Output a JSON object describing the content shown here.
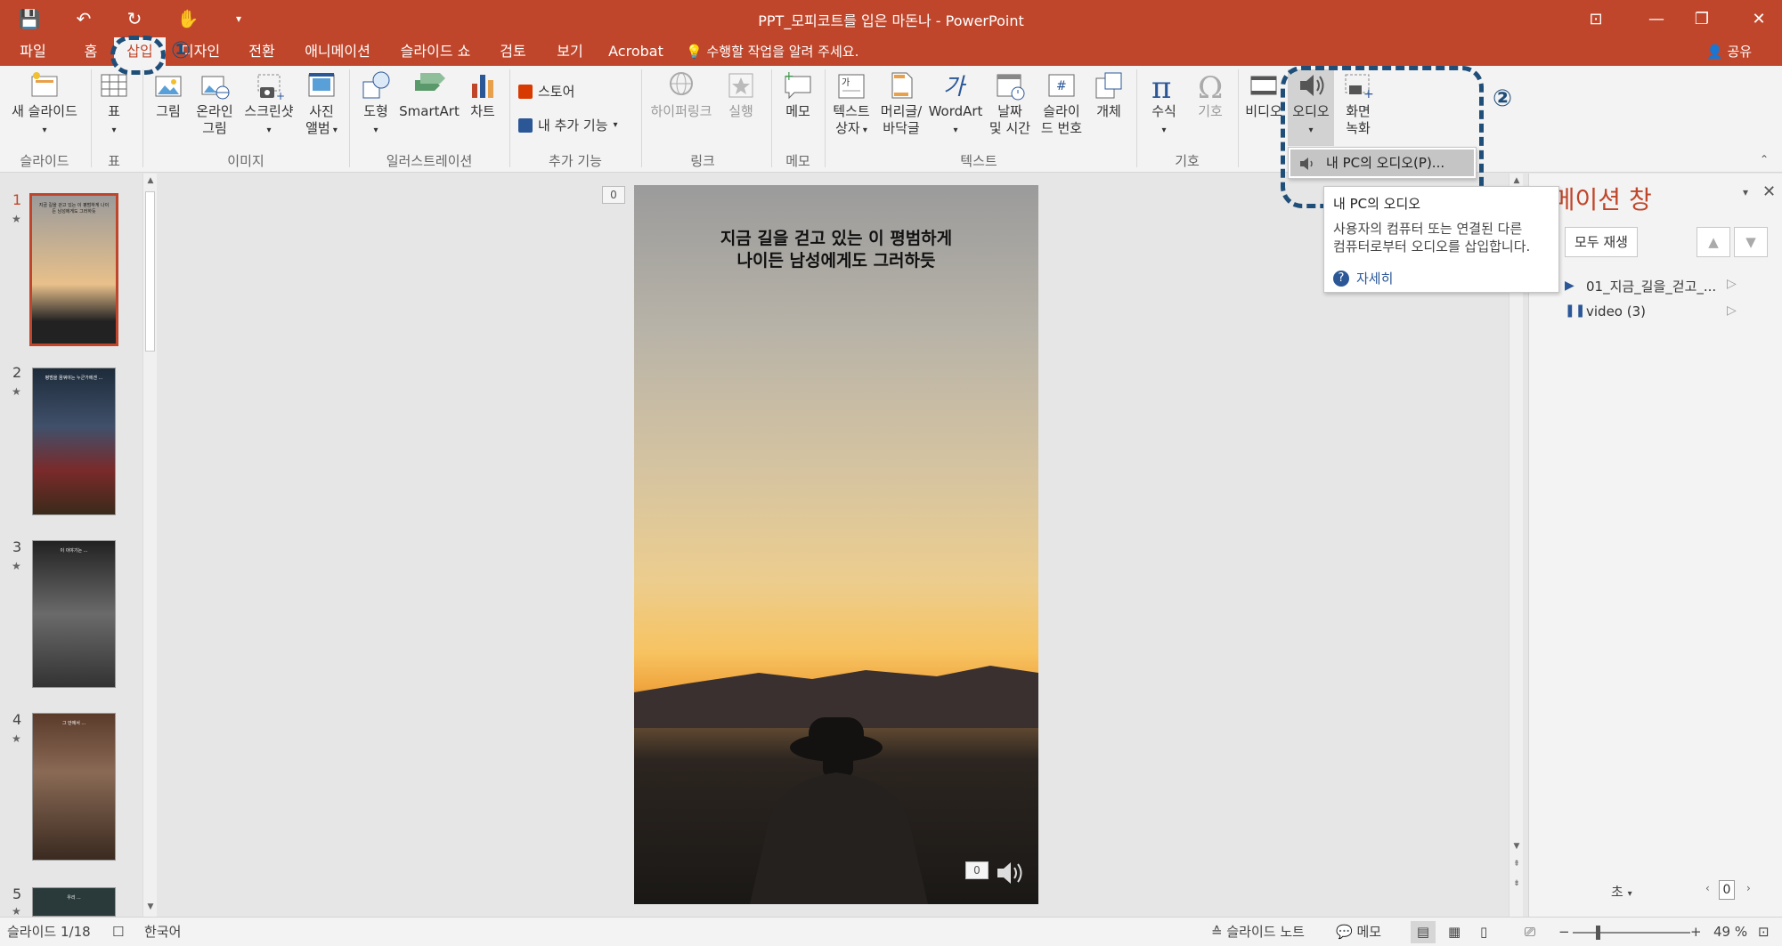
{
  "window": {
    "title": "PPT_모피코트를 입은 마돈나 - PowerPoint",
    "controls": {
      "ribbon_display": "⊡",
      "minimize": "—",
      "restore": "❐",
      "close": "✕"
    },
    "quick_access": {
      "save": "💾",
      "undo": "↶",
      "redo": "↻",
      "touch": "✋",
      "customize": "▾"
    }
  },
  "tabs": [
    {
      "label": "파일"
    },
    {
      "label": "홈"
    },
    {
      "label": "삽입"
    },
    {
      "label": "디자인"
    },
    {
      "label": "전환"
    },
    {
      "label": "애니메이션"
    },
    {
      "label": "슬라이드 쇼"
    },
    {
      "label": "검토"
    },
    {
      "label": "보기"
    },
    {
      "label": "Acrobat"
    }
  ],
  "tell_me": "수행할 작업을 알려 주세요.",
  "share": "공유",
  "ribbon": {
    "new_slide": "새 슬라이드",
    "table": "표",
    "picture": "그림",
    "online_picture_l1": "온라인",
    "online_picture_l2": "그림",
    "screenshot": "스크린샷",
    "photo_album_l1": "사진",
    "photo_album_l2": "앨범",
    "shapes": "도형",
    "smartart": "SmartArt",
    "chart": "차트",
    "store": "스토어",
    "my_addins": "내 추가 기능",
    "hyperlink": "하이퍼링크",
    "action": "실행",
    "comment": "메모",
    "textbox_l1": "텍스트",
    "textbox_l2": "상자",
    "header_footer_l1": "머리글/",
    "header_footer_l2": "바닥글",
    "wordart": "WordArt",
    "datetime_l1": "날짜",
    "datetime_l2": "및 시간",
    "slide_number_l1": "슬라이",
    "slide_number_l2": "드 번호",
    "object": "개체",
    "equation": "수식",
    "symbol": "기호",
    "video": "비디오",
    "audio": "오디오",
    "screen_rec_l1": "화면",
    "screen_rec_l2": "녹화",
    "groups": {
      "slides": "슬라이드",
      "tables": "표",
      "images": "이미지",
      "illustrations": "일러스트레이션",
      "addins": "추가 기능",
      "links": "링크",
      "comments": "메모",
      "text": "텍스트",
      "symbols": "기호"
    }
  },
  "dropdown": {
    "item": "내 PC의 오디오(P)..."
  },
  "tooltip": {
    "title": "내 PC의 오디오",
    "desc_l1": "사용자의 컴퓨터 또는 연결된 다른",
    "desc_l2": "컴퓨터로부터 오디오를 삽입합니다.",
    "more": "자세히"
  },
  "annotations": {
    "one": "①",
    "two": "②"
  },
  "slide": {
    "caption_l1": "지금 길을 걷고 있는 이 평범하게",
    "caption_l2": "나이든 남성에게도 그러하듯",
    "badge": "0",
    "audio_badge": "0"
  },
  "thumbnails": [
    {
      "num": "1",
      "text": "지금 길을 걷고 있는 이 평범하게 나이든 남성에게도 그러하듯"
    },
    {
      "num": "2",
      "text": "평범을 꿈꿔야는 누군가에겐 ..."
    },
    {
      "num": "3",
      "text": "이 이야기는 ..."
    },
    {
      "num": "4",
      "text": "그 안에서 ..."
    },
    {
      "num": "5",
      "text": "우리 ..."
    }
  ],
  "anim_pane": {
    "title": "니메이션 창",
    "play_all": "모두 재생",
    "items": [
      {
        "label": "01_지금_길을_걷고_..."
      },
      {
        "label": "video (3)"
      }
    ],
    "seconds": "초",
    "zoom_value": "0"
  },
  "status": {
    "slide_info": "슬라이드 1/18",
    "language": "한국어",
    "notes": "슬라이드 노트",
    "comments": "메모",
    "zoom": "49 %"
  },
  "colors": {
    "accent": "#c0462b",
    "annotation": "#1f4e79"
  }
}
